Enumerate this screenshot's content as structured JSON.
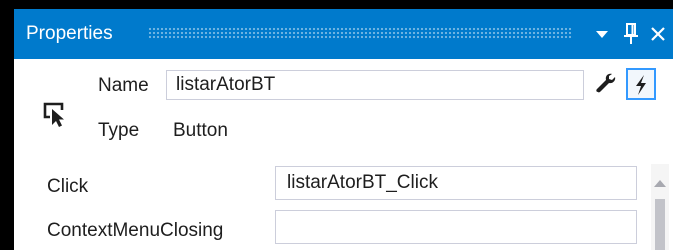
{
  "window": {
    "title": "Properties",
    "title_bar_color": "#007acc",
    "icons": [
      "chevron-down-icon",
      "pin-icon",
      "close-icon"
    ]
  },
  "header": {
    "object_icon": "button-cursor-icon",
    "name_label": "Name",
    "name_value": "listarAtorBT",
    "type_label": "Type",
    "type_value": "Button",
    "toolbar": {
      "properties_icon": "wrench-icon",
      "events_icon": "lightning-icon",
      "active": "events"
    }
  },
  "events": [
    {
      "name": "Click",
      "handler": "listarAtorBT_Click"
    },
    {
      "name": "ContextMenuClosing",
      "handler": ""
    }
  ]
}
